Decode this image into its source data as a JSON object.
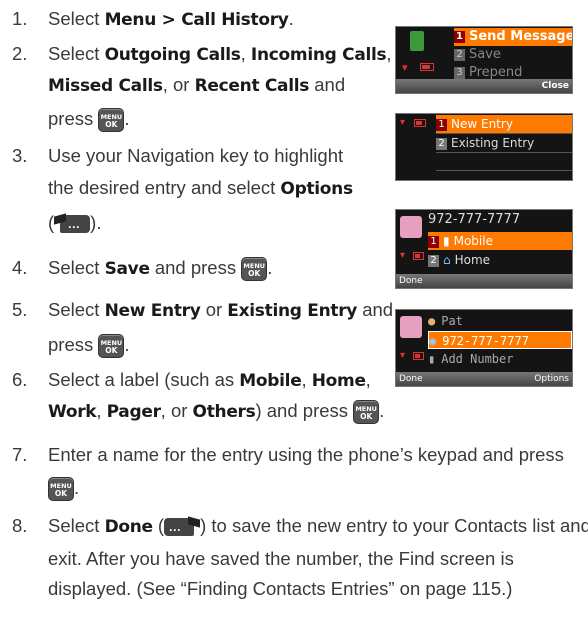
{
  "steps": [
    {
      "num": "1.",
      "lines": [
        [
          "Select ",
          {
            "b": "Menu > Call History"
          },
          "."
        ]
      ]
    },
    {
      "num": "2.",
      "lines": [
        [
          "Select ",
          {
            "b": "Outgoing Calls"
          },
          ", ",
          {
            "b": "Incoming Calls"
          },
          ","
        ],
        [
          {
            "b": "Missed Calls"
          },
          ", or ",
          {
            "b": "Recent Calls"
          },
          " and"
        ],
        [
          "press ",
          {
            "icon": "ok"
          },
          "."
        ]
      ]
    },
    {
      "num": "3.",
      "lines": [
        [
          "Use your Navigation key to highlight"
        ],
        [
          "the desired entry and select ",
          {
            "b": "Options"
          }
        ],
        [
          "(",
          {
            "icon": "right-softkey"
          },
          ")."
        ]
      ]
    },
    {
      "num": "4.",
      "lines": [
        [
          "Select ",
          {
            "b": "Save"
          },
          " and press ",
          {
            "icon": "ok"
          },
          "."
        ]
      ]
    },
    {
      "num": "5.",
      "lines": [
        [
          "Select ",
          {
            "b": "New Entry"
          },
          " or ",
          {
            "b": "Existing Entry"
          },
          " and"
        ],
        [
          "press ",
          {
            "icon": "ok"
          },
          "."
        ]
      ]
    },
    {
      "num": "6.",
      "lines": [
        [
          "Select a label (such as ",
          {
            "b": "Mobile"
          },
          ", ",
          {
            "b": "Home"
          },
          ","
        ],
        [
          {
            "b": "Work"
          },
          ", ",
          {
            "b": "Pager"
          },
          ", or ",
          {
            "b": "Others"
          },
          ") and press ",
          {
            "icon": "ok"
          },
          "."
        ]
      ]
    },
    {
      "num": "7.",
      "lines": [
        [
          "Enter a name for the entry using the phone’s keypad and press"
        ],
        [
          {
            "icon": "ok"
          },
          "."
        ]
      ]
    },
    {
      "num": "8.",
      "lines": [
        [
          "Select ",
          {
            "b": "Done"
          },
          " (",
          {
            "icon": "left-softkey"
          },
          ") to save the new entry to your Contacts list and"
        ],
        [
          "exit. After you have saved the number, the Find screen is"
        ],
        [
          "displayed. (See “Finding Contacts Entries” on page 115.)"
        ]
      ]
    }
  ],
  "ok_key": {
    "top": "MENU",
    "bottom": "OK"
  },
  "softkey_dots": "···",
  "screen1": {
    "items": [
      "Send Message",
      "Save",
      "Prepend"
    ],
    "badges": [
      "1",
      "2",
      "3"
    ],
    "softkey_right": "Close"
  },
  "screen2": {
    "items": [
      "New Entry",
      "Existing Entry"
    ],
    "badges": [
      "1",
      "2"
    ]
  },
  "screen3": {
    "number": "972-777-7777",
    "items": [
      "Mobile",
      "Home"
    ],
    "badges": [
      "1",
      "2"
    ],
    "softkey_left": "Done"
  },
  "screen4": {
    "items": [
      "Pat",
      "972-777-7777",
      "Add Number"
    ],
    "softkey_left": "Done",
    "softkey_right": "Options"
  },
  "colors": {
    "highlight": "#ff7a00",
    "screen_bg": "#141414",
    "badge": "#8a0000"
  }
}
